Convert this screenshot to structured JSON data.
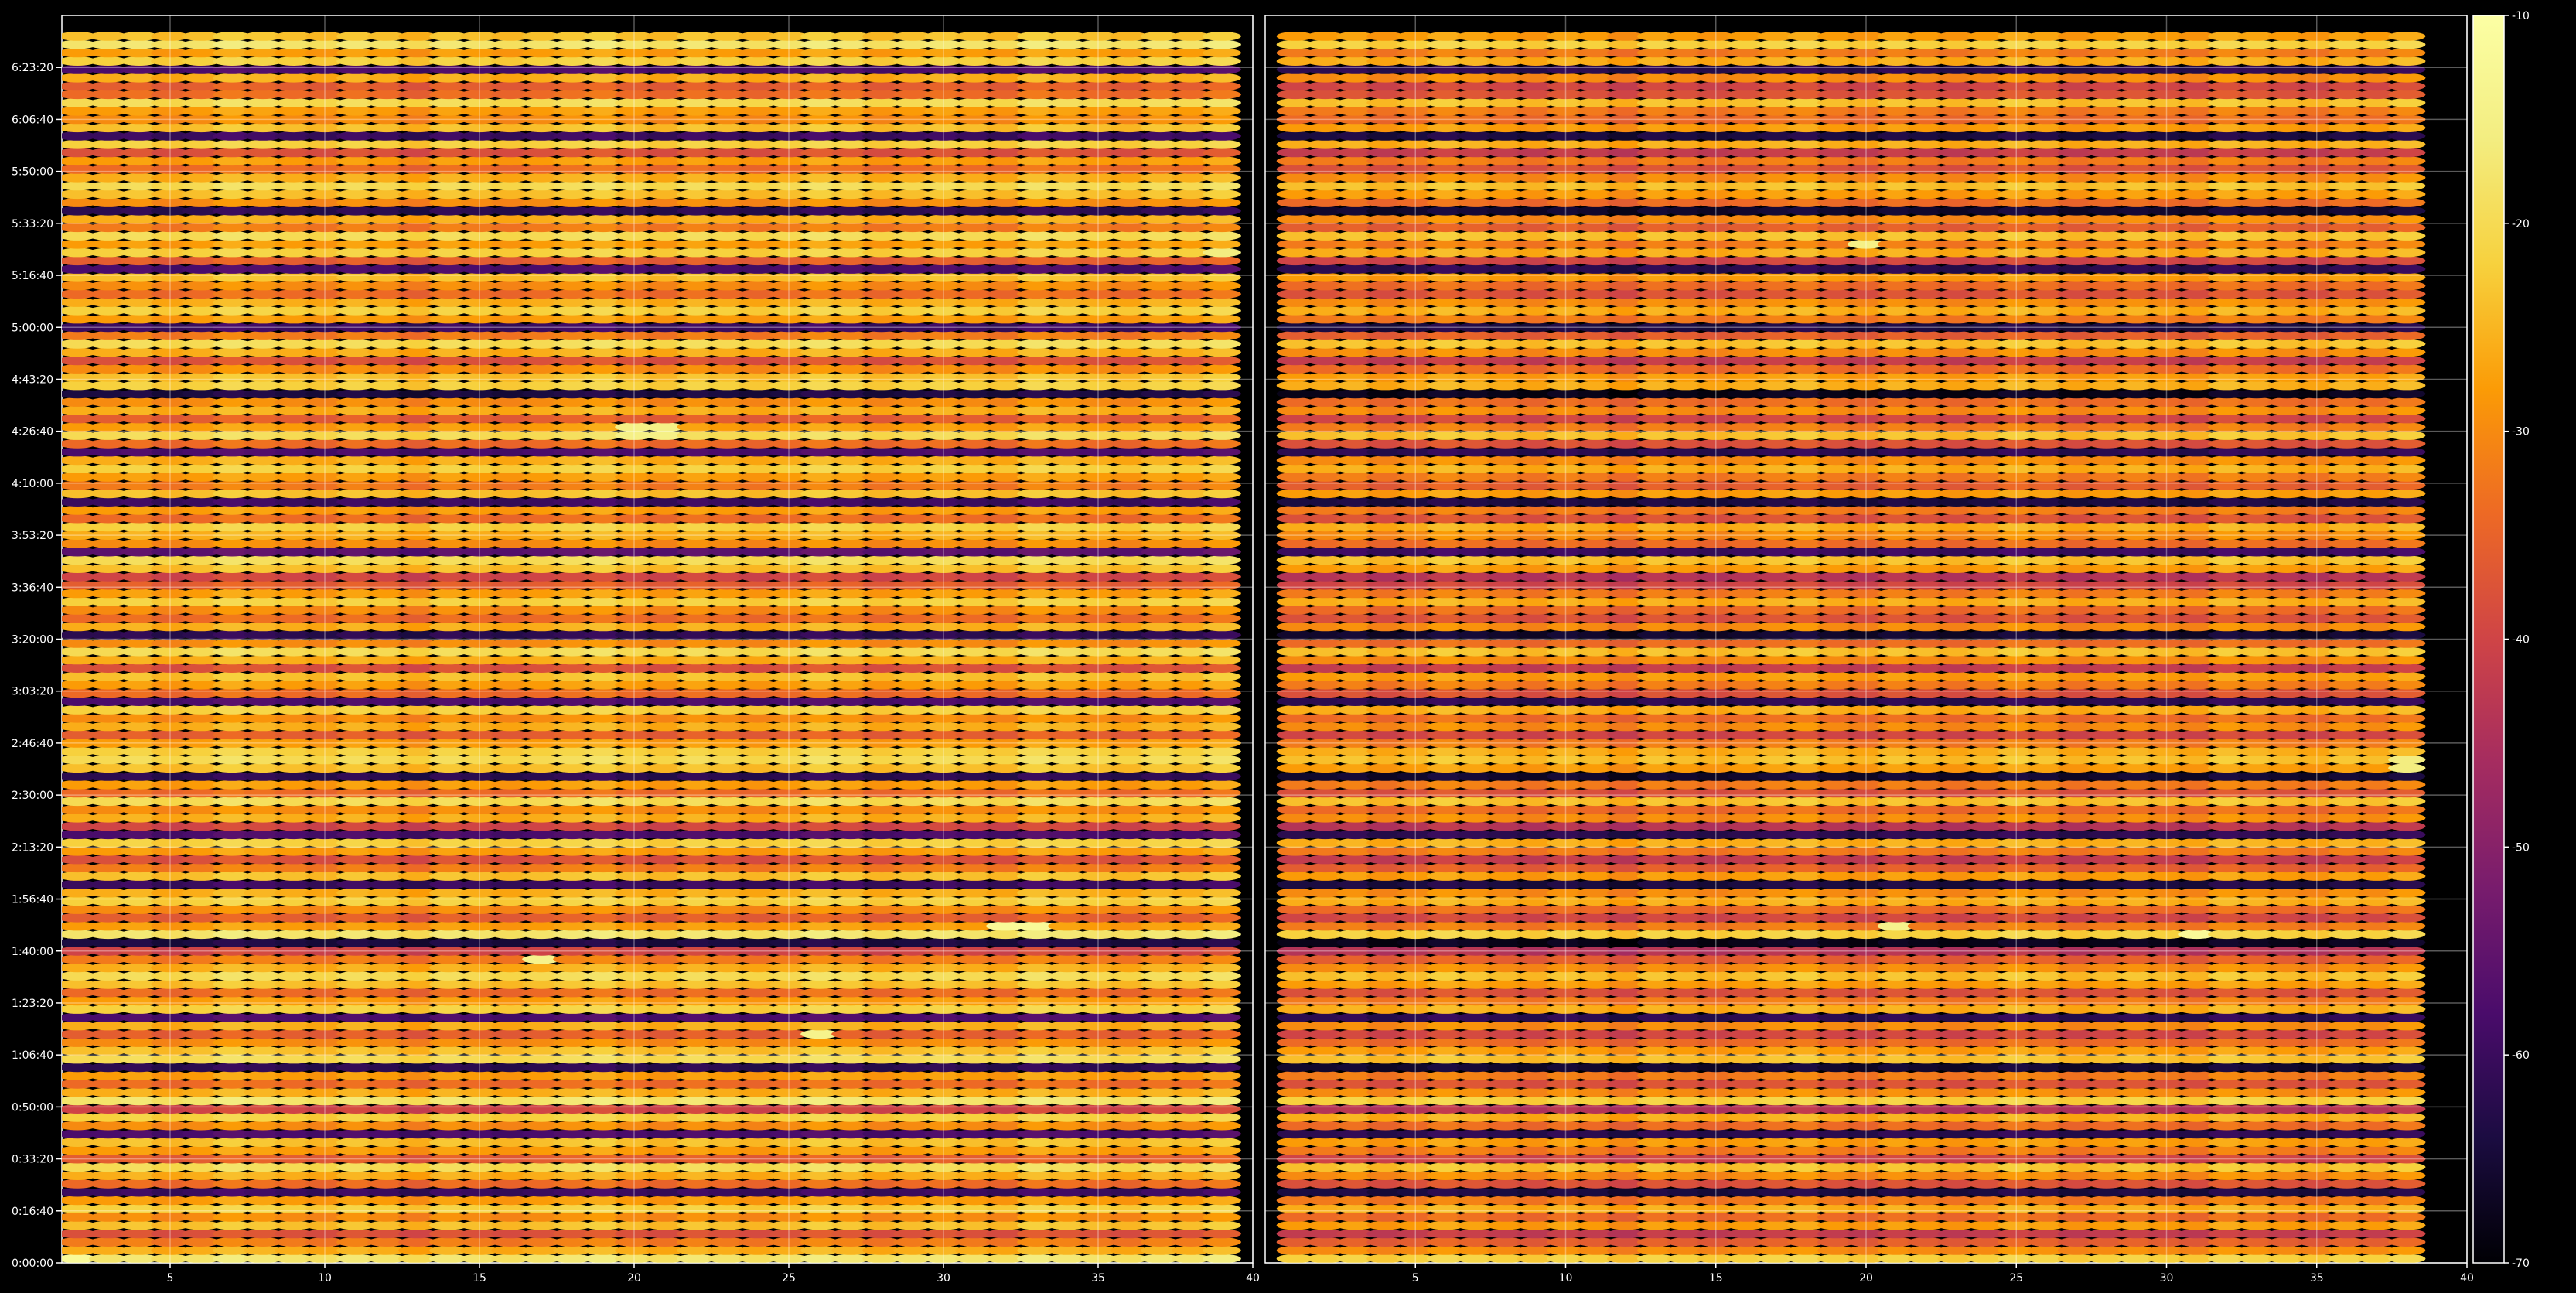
{
  "chart_data": {
    "type": "heatmap",
    "title": "",
    "xlabel": "",
    "ylabel": "",
    "grid": true,
    "panels": [
      {
        "name": "",
        "xlim": [
          1.5,
          40
        ],
        "xticks": [
          "5",
          "10",
          "15",
          "20",
          "25",
          "30",
          "35",
          "40"
        ]
      },
      {
        "name": "",
        "xlim": [
          0,
          40
        ],
        "xticks": [
          "5",
          "10",
          "15",
          "20",
          "25",
          "30",
          "35",
          "40"
        ]
      }
    ],
    "ylim_seconds": [
      0,
      24000
    ],
    "yticks": [
      "0:00:00",
      "0:16:40",
      "0:33:20",
      "0:50:00",
      "1:06:40",
      "1:23:20",
      "1:40:00",
      "1:56:40",
      "2:13:20",
      "2:30:00",
      "2:46:40",
      "3:03:20",
      "3:20:00",
      "3:36:40",
      "3:53:20",
      "4:10:00",
      "4:26:40",
      "4:43:20",
      "5:00:00",
      "5:16:40",
      "5:33:20",
      "5:50:00",
      "6:06:40",
      "6:23:20"
    ],
    "colorbar": {
      "colormap": "inferno",
      "range": [
        -70,
        -10
      ],
      "ticks": [
        "-10",
        "-20",
        "-30",
        "-40",
        "-50",
        "-60",
        "-70"
      ]
    },
    "row_levels_dB": [
      -18,
      -26,
      -32,
      -38,
      -24,
      -30,
      -22,
      -28,
      -60,
      -34,
      -26,
      -20,
      -36,
      -28,
      -24,
      -58,
      -30,
      -22,
      -40,
      -18,
      -26,
      -34,
      -28,
      -62,
      -20,
      -24,
      -30,
      -36,
      -26,
      -58,
      -22,
      -28,
      -34,
      -24,
      -20,
      -26,
      -32,
      -40,
      -64,
      -18,
      -28,
      -36,
      -30,
      -22,
      -26,
      -60,
      -24,
      -32,
      -38,
      -28,
      -22,
      -58,
      -40,
      -26,
      -30,
      -20,
      -34,
      -28,
      -62,
      -24,
      -20,
      -22,
      -28,
      -36,
      -26,
      -30,
      -22,
      -58,
      -34,
      -28,
      -24,
      -38,
      -26,
      -20,
      -30,
      -62,
      -26,
      -34,
      -30,
      -22,
      -28,
      -36,
      -40,
      -24,
      -20,
      -56,
      -30,
      -26,
      -22,
      -34,
      -28,
      -60,
      -24,
      -32,
      -28,
      -22,
      -26,
      -58,
      -34,
      -20,
      -28,
      -36,
      -26,
      -30,
      -64,
      -22,
      -24,
      -30,
      -38,
      -26,
      -20,
      -32,
      -60,
      -28,
      -22,
      -26,
      -34,
      -30,
      -24,
      -58,
      -36,
      -22,
      -28,
      -20,
      -32,
      -26,
      -62,
      -30,
      -24,
      -20,
      -26,
      -34,
      -28,
      -38,
      -22,
      -60,
      -24,
      -30,
      -28,
      -20,
      -34,
      -36,
      -26,
      -58,
      -22,
      -28,
      -18,
      -24
    ],
    "column_levels_dB": [
      0,
      0,
      1,
      -1,
      0,
      2,
      1,
      0,
      -1,
      1,
      0,
      -2,
      1,
      0,
      -1,
      0,
      1,
      2,
      0,
      -1,
      1,
      0,
      -1,
      0,
      2,
      1,
      -1,
      0,
      1,
      0,
      -1,
      2,
      1,
      0,
      -1,
      1,
      0,
      2
    ],
    "hotspots_dB": [
      {
        "panel": 0,
        "x": 2,
        "t": 50,
        "value": -12
      },
      {
        "panel": 0,
        "x": 32.5,
        "t": 6420,
        "value": -12
      },
      {
        "panel": 0,
        "x": 17,
        "t": 5800,
        "value": -14
      },
      {
        "panel": 0,
        "x": 26,
        "t": 4400,
        "value": -14
      },
      {
        "panel": 0,
        "x": 20.5,
        "t": 16000,
        "value": -15
      },
      {
        "panel": 0,
        "x": 39.5,
        "t": 19400,
        "value": -16
      },
      {
        "panel": 1,
        "x": 21,
        "t": 6500,
        "value": -14
      },
      {
        "panel": 1,
        "x": 31,
        "t": 6350,
        "value": -12
      },
      {
        "panel": 1,
        "x": 38.5,
        "t": 9600,
        "value": -16
      },
      {
        "panel": 1,
        "x": 20,
        "t": 19600,
        "value": -15
      }
    ],
    "cell_width_x": 1,
    "cell_height_seconds": 160
  }
}
